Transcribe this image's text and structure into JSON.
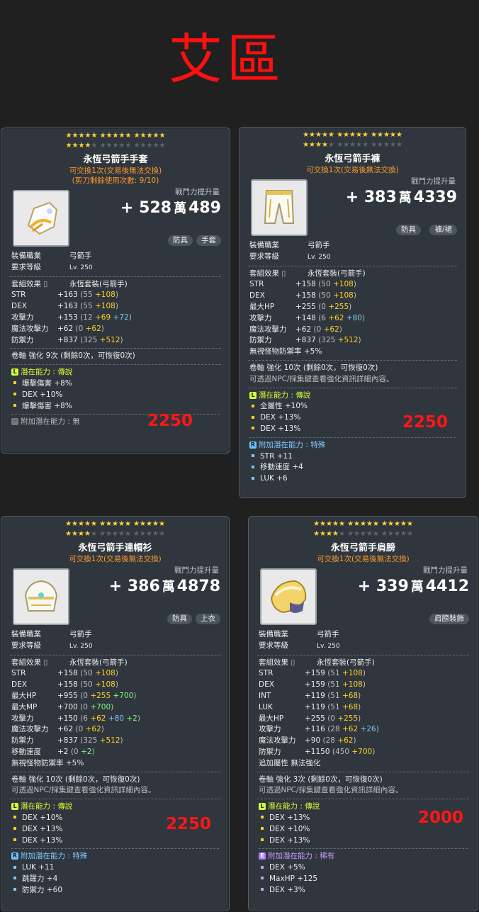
{
  "page_title": "艾區",
  "cards": [
    {
      "stars_row1": "★★★★★ ★★★★★ ★★★★★",
      "stars_row2_lit": "★★★★",
      "stars_row2_dim": "★ ★★★★★ ★★★★★",
      "name": "永恆弓箭手手套",
      "trade": "可交換1次(交易後無法交換)",
      "note": "(剪刀剩餘使用次數: 9/10)",
      "power_label": "戰鬥力提升量",
      "power_plus": "+",
      "power_man": "528",
      "power_man_unit": "萬",
      "power_rest": "489",
      "badges": [
        "防具",
        "手套"
      ],
      "job_label": "裝備職業",
      "job_value": "弓箭手",
      "req_label": "要求等級",
      "req_value": "Lv. 250",
      "set_label": "套組效果",
      "set_value": "永恆套裝(弓箭手)",
      "stats": [
        {
          "k": "STR",
          "v": "+163",
          "base": "(55",
          "add": "+108",
          "close": ")"
        },
        {
          "k": "DEX",
          "v": "+163",
          "base": "(55",
          "add": "+108",
          "close": ")"
        },
        {
          "k": "攻擊力",
          "v": "+153",
          "base": "(12",
          "add": "+69",
          "add2": "+72",
          "close": ")"
        },
        {
          "k": "魔法攻擊力",
          "v": "+62",
          "base": "(0",
          "add": "+62",
          "close": ")"
        },
        {
          "k": "防禦力",
          "v": "+837",
          "base": "(325",
          "add": "+512",
          "close": ")"
        }
      ],
      "scroll": "卷軸 強化 9次 (剩餘0次，可恢復0次)",
      "potential_label": "潛在能力 : 傳說",
      "potentials": [
        "爆擊傷害 +8%",
        "DEX +10%",
        "爆擊傷害 +8%"
      ],
      "bonus_label": "附加潛在能力 : 無",
      "price": "2250"
    },
    {
      "stars_row1": "★★★★★ ★★★★★ ★★★★★",
      "stars_row2_lit": "★★★★",
      "stars_row2_dim": "★ ★★★★★ ★★★★★",
      "name": "永恆弓箭手褲",
      "trade": "可交換1次(交易後無法交換)",
      "power_label": "戰鬥力提升量",
      "power_plus": "+",
      "power_man": "383",
      "power_man_unit": "萬",
      "power_rest": "4339",
      "badges": [
        "防具",
        "褲/裙"
      ],
      "job_label": "裝備職業",
      "job_value": "弓箭手",
      "req_label": "要求等級",
      "req_value": "Lv. 250",
      "set_label": "套組效果",
      "set_value": "永恆套裝(弓箭手)",
      "stats": [
        {
          "k": "STR",
          "v": "+158",
          "base": "(50",
          "add": "+108",
          "close": ")"
        },
        {
          "k": "DEX",
          "v": "+158",
          "base": "(50",
          "add": "+108",
          "close": ")"
        },
        {
          "k": "最大HP",
          "v": "+255",
          "base": "(0",
          "add": "+255",
          "close": ")"
        },
        {
          "k": "攻擊力",
          "v": "+148",
          "base": "(6",
          "add": "+62",
          "add2": "+80",
          "close": ")"
        },
        {
          "k": "魔法攻擊力",
          "v": "+62",
          "base": "(0",
          "add": "+62",
          "close": ")"
        },
        {
          "k": "防禦力",
          "v": "+837",
          "base": "(325",
          "add": "+512",
          "close": ")"
        }
      ],
      "extra": "無視怪物防禦率  +5%",
      "scroll": "卷軸 強化 10次 (剩餘0次，可恢復0次)",
      "npc_hint": "可透過NPC/採集鍵查看強化資訊詳細內容。",
      "potential_label": "潛在能力 : 傳說",
      "potentials": [
        "全屬性 +10%",
        "DEX +13%",
        "DEX +13%"
      ],
      "bonus_label": "附加潛在能力 : 特殊",
      "bonus": [
        "STR +11",
        "移動速度 +4",
        "LUK +6"
      ],
      "price": "2250"
    },
    {
      "stars_row1": "★★★★★ ★★★★★ ★★★★★",
      "stars_row2_lit": "★★★★",
      "stars_row2_dim": "★ ★★★★★ ★★★★★",
      "name": "永恆弓箭手連帽衫",
      "trade": "可交換1次(交易後無法交換)",
      "power_label": "戰鬥力提升量",
      "power_plus": "+",
      "power_man": "386",
      "power_man_unit": "萬",
      "power_rest": "4878",
      "badges": [
        "防具",
        "上衣"
      ],
      "job_label": "裝備職業",
      "job_value": "弓箭手",
      "req_label": "要求等級",
      "req_value": "Lv. 250",
      "set_label": "套組效果",
      "set_value": "永恆套裝(弓箭手)",
      "stats": [
        {
          "k": "STR",
          "v": "+158",
          "base": "(50",
          "add": "+108",
          "close": ")"
        },
        {
          "k": "DEX",
          "v": "+158",
          "base": "(50",
          "add": "+108",
          "close": ")"
        },
        {
          "k": "最大HP",
          "v": "+955",
          "base": "(0",
          "add": "+255",
          "add3": "+700",
          "close": ")"
        },
        {
          "k": "最大MP",
          "v": "+700",
          "base": "(0",
          "add3": "+700",
          "close": ")"
        },
        {
          "k": "攻擊力",
          "v": "+150",
          "base": "(6",
          "add": "+62",
          "add2": "+80",
          "add3": "+2",
          "close": ")"
        },
        {
          "k": "魔法攻擊力",
          "v": "+62",
          "base": "(0",
          "add": "+62",
          "close": ")"
        },
        {
          "k": "防禦力",
          "v": "+837",
          "base": "(325",
          "add": "+512",
          "close": ")"
        },
        {
          "k": "移動速度",
          "v": "+2",
          "base": "(0",
          "add3": "+2",
          "close": ")"
        }
      ],
      "extra": "無視怪物防禦率  +5%",
      "scroll": "卷軸 強化 10次 (剩餘0次，可恢復0次)",
      "npc_hint": "可透過NPC/採集鍵查看強化資訊詳細內容。",
      "potential_label": "潛在能力 : 傳說",
      "potentials": [
        "DEX +10%",
        "DEX +13%",
        "DEX +13%"
      ],
      "bonus_label": "附加潛在能力 : 特殊",
      "bonus": [
        "LUK +11",
        "跳躍力 +4",
        "防禦力 +60"
      ],
      "price": "2250"
    },
    {
      "stars_row1": "★★★★★ ★★★★★ ★★★★★",
      "stars_row2_lit": "★★★★",
      "stars_row2_dim": "★ ★★★★★ ★★★★★",
      "name": "永恆弓箭手肩膀",
      "trade": "可交換1次(交易後無法交換)",
      "power_label": "戰鬥力提升量",
      "power_plus": "+",
      "power_man": "339",
      "power_man_unit": "萬",
      "power_rest": "4412",
      "badges": [
        "肩膀裝飾"
      ],
      "job_label": "裝備職業",
      "job_value": "弓箭手",
      "req_label": "要求等級",
      "req_value": "Lv. 250",
      "set_label": "套組效果",
      "set_value": "永恆套裝(弓箭手)",
      "stats": [
        {
          "k": "STR",
          "v": "+159",
          "base": "(51",
          "add": "+108",
          "close": ")"
        },
        {
          "k": "DEX",
          "v": "+159",
          "base": "(51",
          "add": "+108",
          "close": ")"
        },
        {
          "k": "INT",
          "v": "+119",
          "base": "(51",
          "add": "+68",
          "close": ")"
        },
        {
          "k": "LUK",
          "v": "+119",
          "base": "(51",
          "add": "+68",
          "close": ")"
        },
        {
          "k": "最大HP",
          "v": "+255",
          "base": "(0",
          "add": "+255",
          "close": ")"
        },
        {
          "k": "攻擊力",
          "v": "+116",
          "base": "(28",
          "add": "+62",
          "add2": "+26",
          "close": ")"
        },
        {
          "k": "魔法攻擊力",
          "v": "+90",
          "base": "(28",
          "add": "+62",
          "close": ")"
        },
        {
          "k": "防禦力",
          "v": "+1150",
          "base": "(450",
          "add": "+700",
          "close": ")"
        }
      ],
      "extra": "追加屬性 無法強化",
      "scroll": "卷軸 強化 3次 (剩餘0次，可恢復0次)",
      "npc_hint": "可透過NPC/採集鍵查看強化資訊詳細內容。",
      "potential_label": "潛在能力 : 傳說",
      "potentials": [
        "DEX +13%",
        "DEX +10%",
        "DEX +13%"
      ],
      "bonus_label": "附加潛在能力 : 稀有",
      "bonus": [
        "DEX +5%",
        "MaxHP +125",
        "DEX +3%"
      ],
      "price": "2000"
    }
  ]
}
